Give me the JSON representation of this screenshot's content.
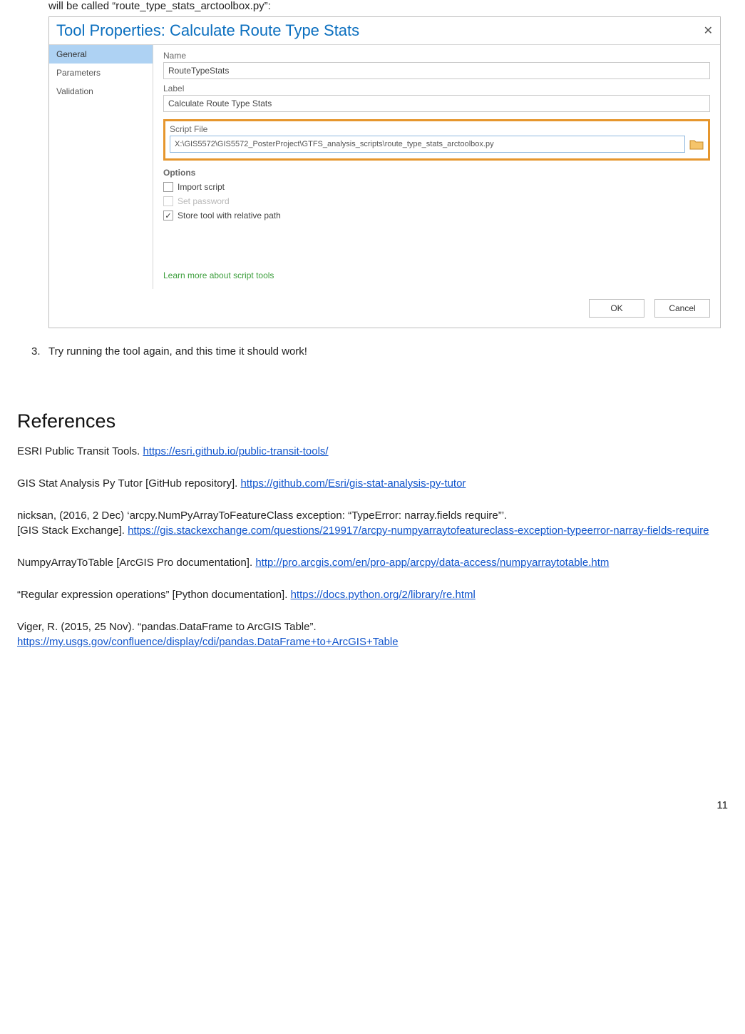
{
  "intro": "will be called “route_type_stats_arctoolbox.py”:",
  "dialog": {
    "title": "Tool Properties: Calculate Route Type Stats",
    "sidebar": {
      "general": "General",
      "parameters": "Parameters",
      "validation": "Validation"
    },
    "fields": {
      "name_label": "Name",
      "name_value": "RouteTypeStats",
      "label_label": "Label",
      "label_value": "Calculate Route Type Stats",
      "script_label": "Script File",
      "script_value": "X:\\GIS5572\\GIS5572_PosterProject\\GTFS_analysis_scripts\\route_type_stats_arctoolbox.py"
    },
    "options": {
      "header": "Options",
      "import_script": "Import script",
      "set_password": "Set password",
      "store_relative": "Store tool with relative path"
    },
    "learn_more": "Learn more about script tools",
    "buttons": {
      "ok": "OK",
      "cancel": "Cancel"
    }
  },
  "step3": {
    "num": "3.",
    "text": "Try running the tool again, and this time it should work!"
  },
  "refs": {
    "heading": "References",
    "r1_pre": "ESRI Public Transit Tools. ",
    "r1_link": "https://esri.github.io/public-transit-tools/",
    "r2_pre": "GIS Stat Analysis Py Tutor [GitHub repository]. ",
    "r2_link": "https://github.com/Esri/gis-stat-analysis-py-tutor",
    "r3_line1": "nicksan, (2016, 2 Dec) ‘arcpy.NumPyArrayToFeatureClass exception: “TypeError: narray.fields require”’.",
    "r3_line2_pre": "[GIS Stack Exchange]. ",
    "r3_link": "https://gis.stackexchange.com/questions/219917/arcpy-numpyarraytofeatureclass-exception-typeerror-narray-fields-require",
    "r4_pre": "NumpyArrayToTable [ArcGIS Pro documentation]. ",
    "r4_link": "http://pro.arcgis.com/en/pro-app/arcpy/data-access/numpyarraytotable.htm",
    "r5_pre": "“Regular expression operations” [Python documentation]. ",
    "r5_link": "https://docs.python.org/2/library/re.html",
    "r6_line1": "Viger, R. (2015, 25 Nov). “pandas.DataFrame to ArcGIS Table”.",
    "r6_link": "https://my.usgs.gov/confluence/display/cdi/pandas.DataFrame+to+ArcGIS+Table"
  },
  "page_number": "11"
}
